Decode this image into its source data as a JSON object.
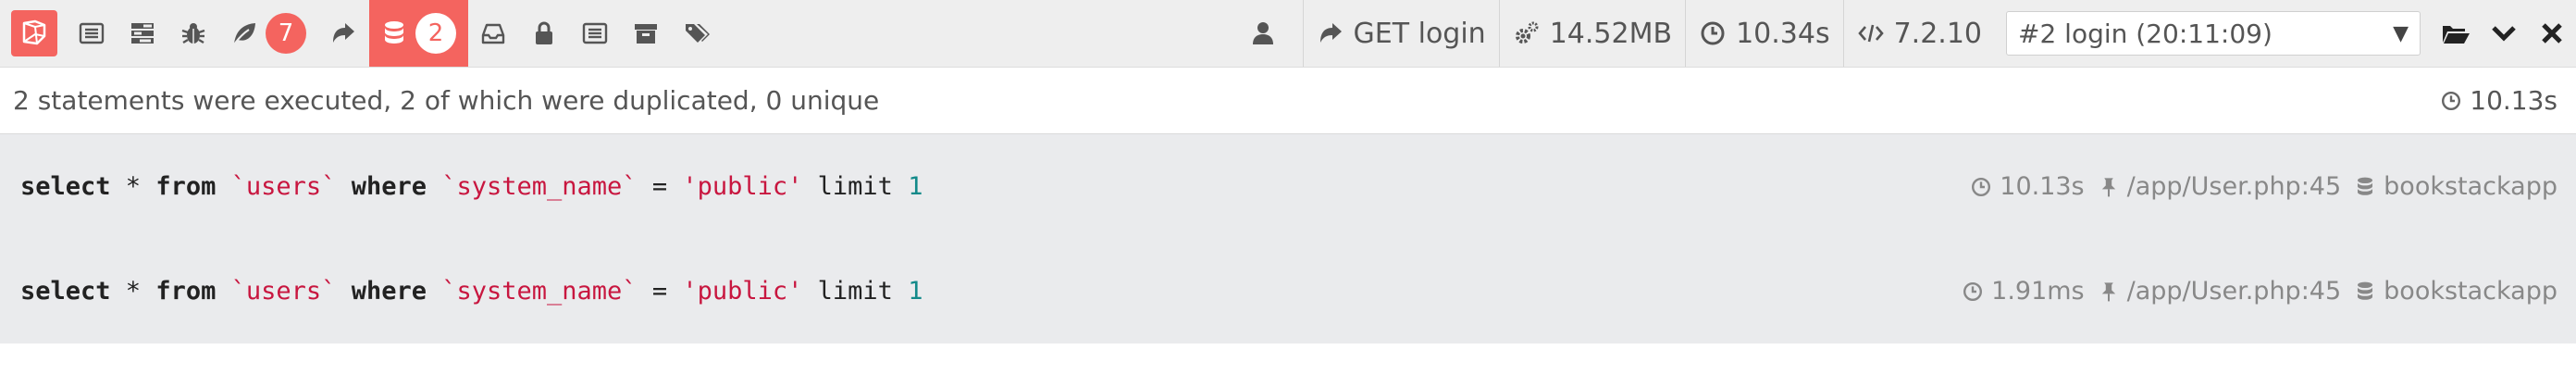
{
  "toolbar": {
    "badges": {
      "exceptions": "7",
      "queries": "2"
    },
    "user_icon": "user-icon",
    "route": "GET login",
    "memory": "14.52MB",
    "duration": "10.34s",
    "php_version": "7.2.10",
    "dataset": "#2 login (20:11:09)",
    "colors": {
      "accent": "#f4645f",
      "bar_bg": "#eeeeee"
    }
  },
  "status": {
    "summary": "2 statements were executed, 2 of which were duplicated, 0 unique",
    "total_time": "10.13s"
  },
  "statements": [
    {
      "sql_select": "select",
      "sql_star": " * ",
      "sql_from": "from",
      "sql_table": "`users`",
      "sql_where": "where",
      "sql_column": "`system_name`",
      "sql_eq": " = ",
      "sql_value": "'public'",
      "sql_limit": "limit",
      "sql_limit_val": "1",
      "duration": "10.13s",
      "source": "/app/User.php:45",
      "connection": "bookstackapp"
    },
    {
      "sql_select": "select",
      "sql_star": " * ",
      "sql_from": "from",
      "sql_table": "`users`",
      "sql_where": "where",
      "sql_column": "`system_name`",
      "sql_eq": " = ",
      "sql_value": "'public'",
      "sql_limit": "limit",
      "sql_limit_val": "1",
      "duration": "1.91ms",
      "source": "/app/User.php:45",
      "connection": "bookstackapp"
    }
  ]
}
